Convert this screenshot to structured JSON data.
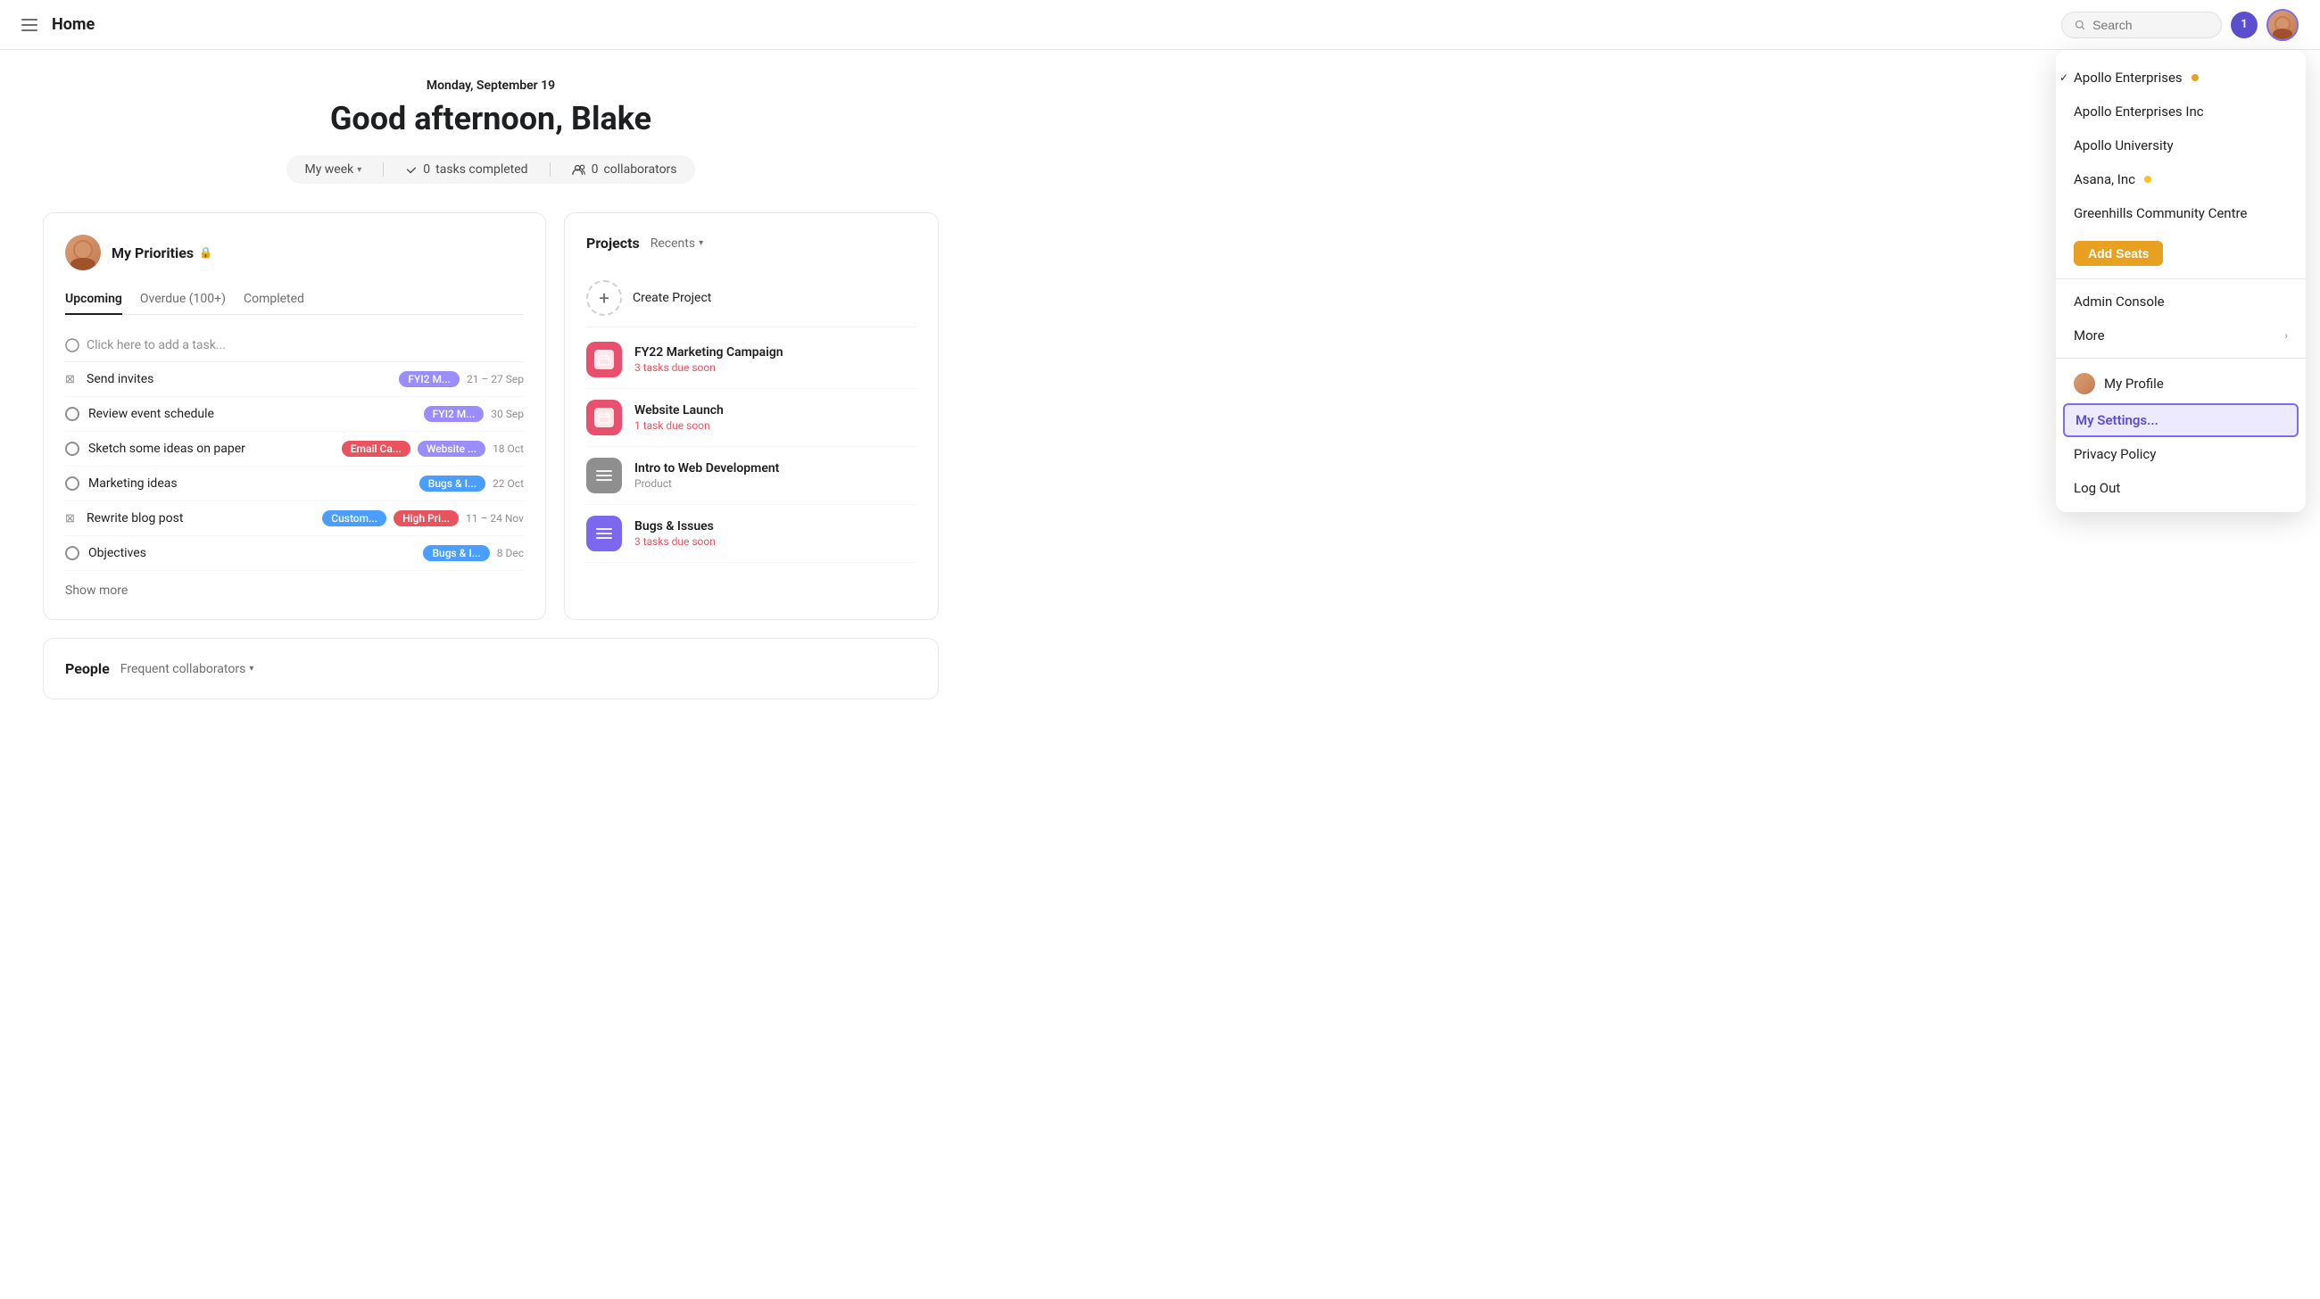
{
  "app": {
    "title": "Home"
  },
  "topnav": {
    "search_placeholder": "Search",
    "notification_count": "1"
  },
  "hero": {
    "date": "Monday, September 19",
    "greeting": "Good afternoon, Blake",
    "week_label": "My week",
    "tasks_completed": "0",
    "tasks_label": "tasks completed",
    "collaborators_count": "0",
    "collaborators_label": "collaborators"
  },
  "priorities": {
    "title": "My Priorities",
    "tabs": [
      "Upcoming",
      "Overdue (100+)",
      "Completed"
    ],
    "active_tab": "Upcoming",
    "add_task_placeholder": "Click here to add a task...",
    "tasks": [
      {
        "name": "Send invites",
        "icon": "hourglass",
        "tag1": "FYI2 M...",
        "tag1_color": "purple",
        "date": "21 – 27 Sep"
      },
      {
        "name": "Review event schedule",
        "icon": "check",
        "tag1": "FYI2 M...",
        "tag1_color": "purple",
        "date": "30 Sep"
      },
      {
        "name": "Sketch some ideas on paper",
        "icon": "check",
        "tag1": "Email Ca...",
        "tag1_color": "red",
        "tag2": "Website ...",
        "tag2_color": "purple",
        "date": "18 Oct"
      },
      {
        "name": "Marketing ideas",
        "icon": "check",
        "tag1": "Bugs & I...",
        "tag1_color": "blue",
        "date": "22 Oct"
      },
      {
        "name": "Rewrite blog post",
        "icon": "hourglass",
        "tag1": "Custom...",
        "tag1_color": "blue",
        "tag2": "High Pri...",
        "tag2_color": "red",
        "date": "11 – 24 Nov"
      },
      {
        "name": "Objectives",
        "icon": "check",
        "tag1": "Bugs & I...",
        "tag1_color": "blue",
        "date": "8 Dec"
      }
    ],
    "show_more": "Show more"
  },
  "projects": {
    "title": "Projects",
    "recents": "Recents",
    "create_label": "Create Project",
    "items": [
      {
        "name": "FY22 Marketing Campaign",
        "subtitle": "3 tasks due soon",
        "subtitle_type": "due",
        "icon_type": "calendar",
        "icon_color": "pink"
      },
      {
        "name": "Website Launch",
        "subtitle": "1 task due soon",
        "subtitle_type": "due",
        "icon_type": "calendar",
        "icon_color": "pink"
      },
      {
        "name": "Intro to Web Development",
        "subtitle": "Product",
        "subtitle_type": "normal",
        "icon_type": "list",
        "icon_color": "gray"
      },
      {
        "name": "Bugs & Issues",
        "subtitle": "3 tasks due soon",
        "subtitle_type": "due",
        "icon_type": "list",
        "icon_color": "purple"
      }
    ]
  },
  "people": {
    "title": "People",
    "filter": "Frequent collaborators"
  },
  "dropdown": {
    "organizations": [
      {
        "name": "Apollo Enterprises",
        "dot": "orange",
        "checked": true
      },
      {
        "name": "Apollo Enterprises Inc",
        "dot": null,
        "checked": false
      },
      {
        "name": "Apollo University",
        "dot": null,
        "checked": false
      },
      {
        "name": "Asana, Inc",
        "dot": "yellow",
        "checked": false
      },
      {
        "name": "Greenhills Community Centre",
        "dot": null,
        "checked": false
      }
    ],
    "add_seats_label": "Add Seats",
    "admin_console_label": "Admin Console",
    "more_label": "More",
    "my_profile_label": "My Profile",
    "my_settings_label": "My Settings...",
    "privacy_policy_label": "Privacy Policy",
    "log_out_label": "Log Out"
  }
}
